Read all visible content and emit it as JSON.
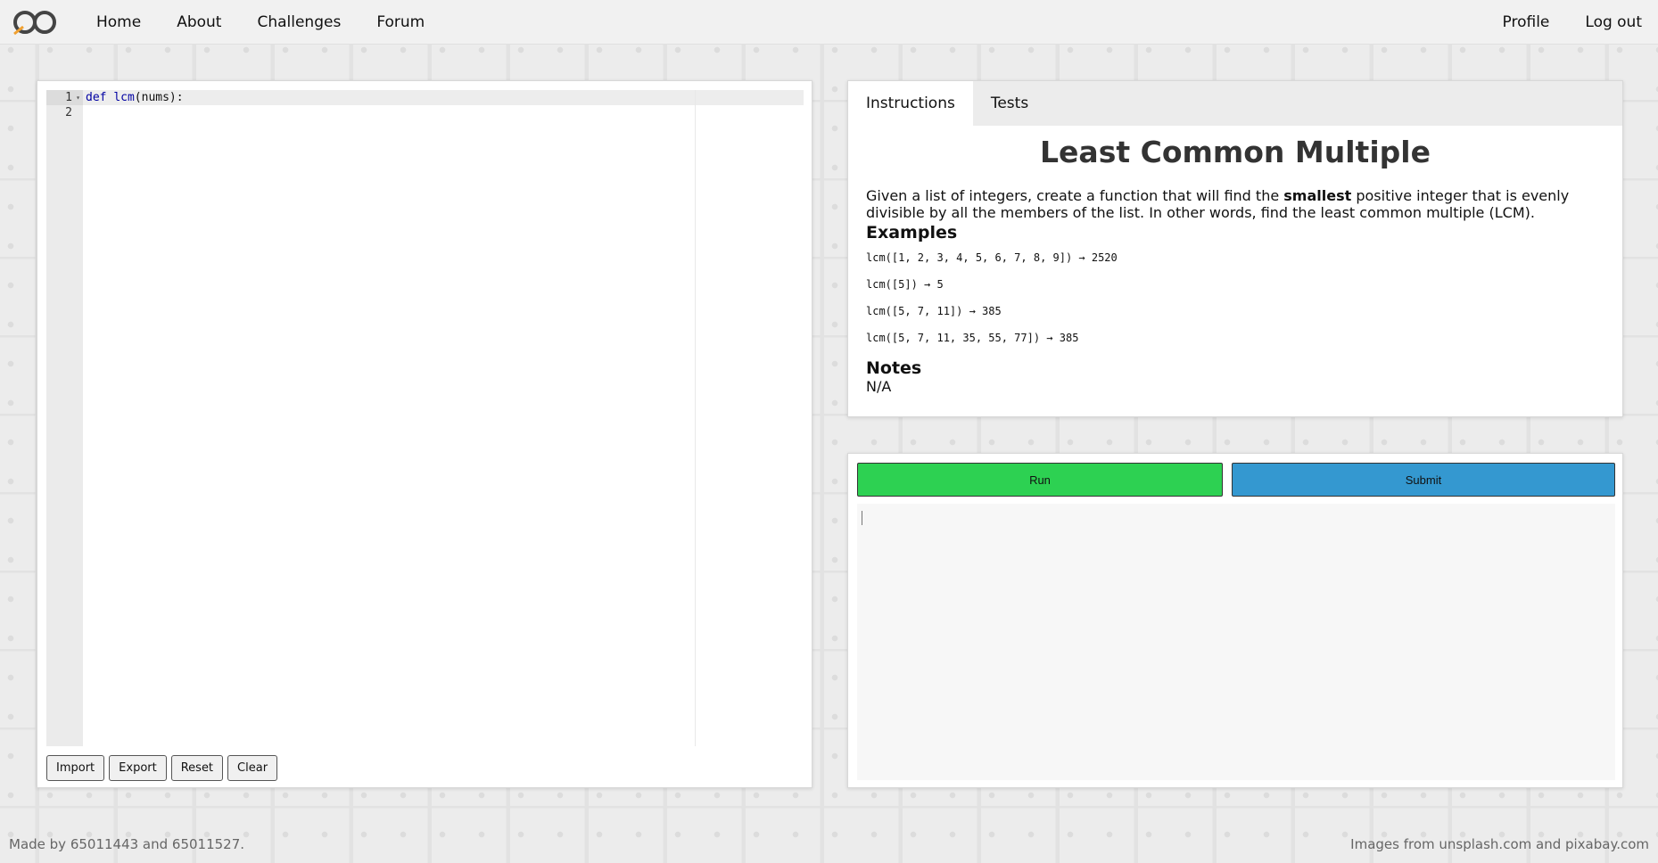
{
  "nav": {
    "links": [
      "Home",
      "About",
      "Challenges",
      "Forum"
    ],
    "right": [
      "Profile",
      "Log out"
    ]
  },
  "editor": {
    "line_numbers": [
      "1",
      "2"
    ],
    "code": {
      "kw": "def",
      "fn": "lcm",
      "rest": "(nums):"
    },
    "buttons": [
      "Import",
      "Export",
      "Reset",
      "Clear"
    ]
  },
  "instructions": {
    "tabs": [
      "Instructions",
      "Tests"
    ],
    "title": "Least Common Multiple",
    "desc_before": "Given a list of integers, create a function that will find the ",
    "desc_bold": "smallest",
    "desc_after": " positive integer that is evenly divisible by all the members of the list. In other words, find the least common multiple (LCM).",
    "examples_heading": "Examples",
    "examples": [
      "lcm([1, 2, 3, 4, 5, 6, 7, 8, 9]) → 2520",
      "lcm([5]) → 5",
      "lcm([5, 7, 11]) → 385",
      "lcm([5, 7, 11, 35, 55, 77]) → 385"
    ],
    "notes_heading": "Notes",
    "notes_text": "N/A"
  },
  "actions": {
    "run": "Run",
    "submit": "Submit"
  },
  "footer": {
    "left": "Made by 65011443 and 65011527.",
    "right": "Images from unsplash.com and pixabay.com"
  },
  "colors": {
    "run": "#2dd152",
    "submit": "#3498d0"
  }
}
